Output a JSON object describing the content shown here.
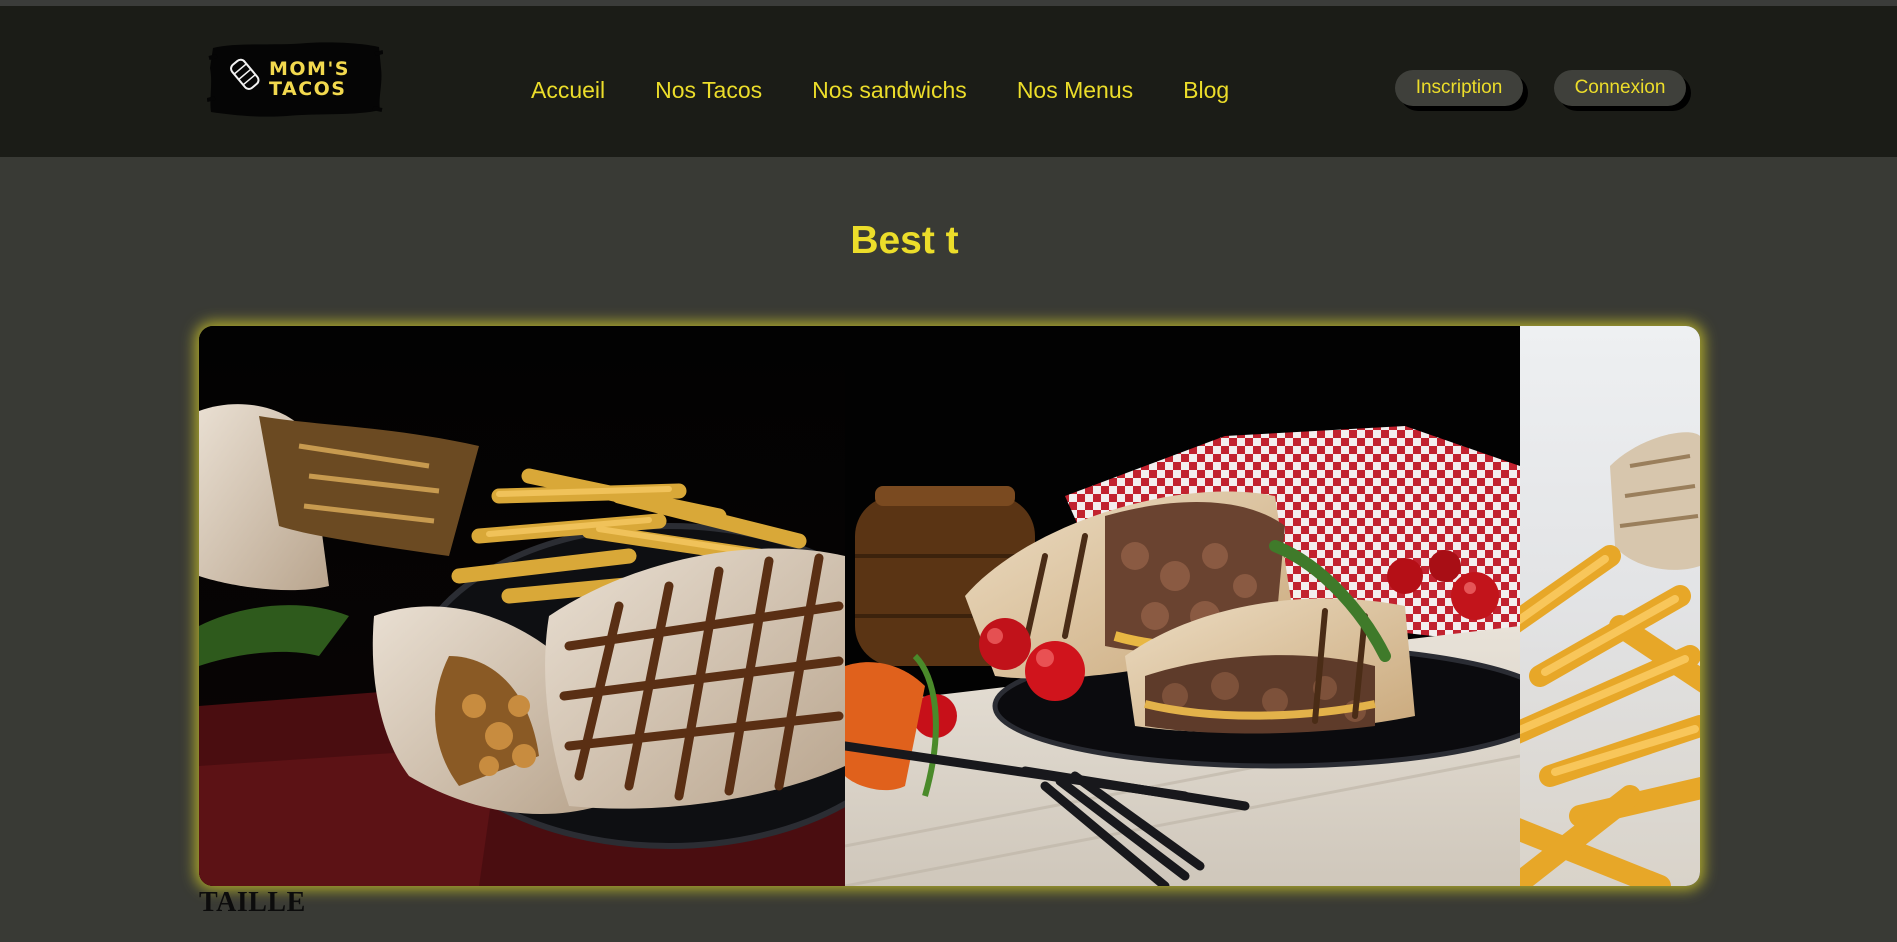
{
  "brand": {
    "logo_text_line1": "MOM'S",
    "logo_text_line2": "TACOS",
    "colors": {
      "accent": "#ecdd2a",
      "header_bg": "#1b1c17",
      "page_bg": "#393a35",
      "button_bg": "#3f403b"
    }
  },
  "nav": {
    "items": [
      {
        "label": "Accueil"
      },
      {
        "label": "Nos Tacos"
      },
      {
        "label": "Nos sandwichs"
      },
      {
        "label": "Nos Menus"
      },
      {
        "label": "Blog"
      }
    ]
  },
  "auth": {
    "signup_label": "Inscription",
    "login_label": "Connexion"
  },
  "hero": {
    "title": "Best t"
  },
  "carousel": {
    "slides": [
      {
        "image": "grilled-tacos-with-fries-photo"
      },
      {
        "image": "beef-wrap-with-tomatoes-photo"
      },
      {
        "image": "fries-and-wrap-photo"
      }
    ]
  },
  "section": {
    "label": "TAILLE"
  }
}
